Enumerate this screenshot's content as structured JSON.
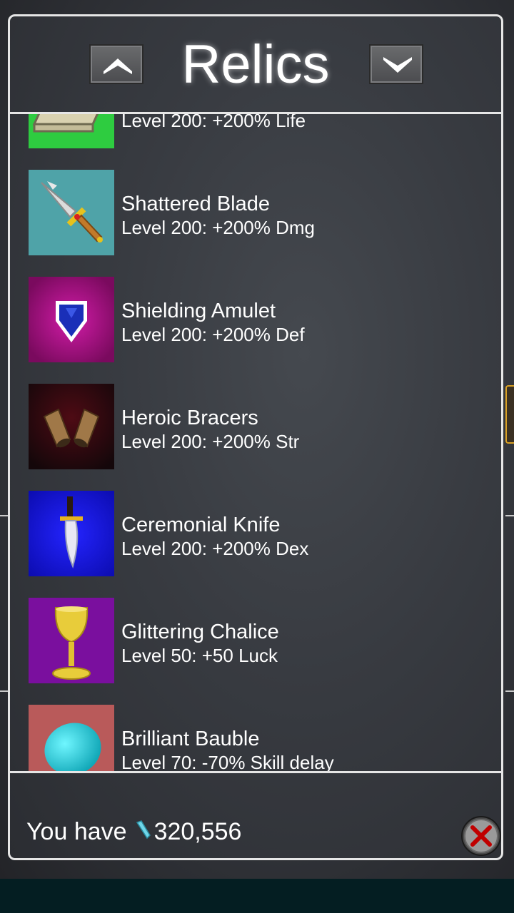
{
  "window": {
    "title": "Relics"
  },
  "nav": {
    "up_icon": "chevron-up-icon",
    "down_icon": "chevron-down-icon"
  },
  "items": [
    {
      "name": "",
      "desc": "Level 200: +200% Life",
      "bg": "#2ecc40",
      "icon": "book-icon"
    },
    {
      "name": "Shattered Blade",
      "desc": "Level 200: +200% Dmg",
      "bg": "#4fa3a8",
      "icon": "sword-icon"
    },
    {
      "name": "Shielding Amulet",
      "desc": "Level 200: +200% Def",
      "bg": "#b0158c",
      "icon": "amulet-icon"
    },
    {
      "name": "Heroic Bracers",
      "desc": "Level 200: +200% Str",
      "bg": "#4a0912",
      "icon": "bracers-icon"
    },
    {
      "name": "Ceremonial Knife",
      "desc": "Level 200: +200% Dex",
      "bg": "#1414d8",
      "icon": "knife-icon"
    },
    {
      "name": "Glittering Chalice",
      "desc": "Level 50: +50 Luck",
      "bg": "#7a0f9e",
      "icon": "chalice-icon"
    },
    {
      "name": "Brilliant Bauble",
      "desc": "Level 70: -70% Skill delay",
      "bg": "#b95a5a",
      "icon": "bauble-icon"
    }
  ],
  "footer": {
    "label": "You have",
    "amount": "320,556",
    "currency_icon": "crystal-icon"
  },
  "colors": {
    "panel_border": "#e6e6e6",
    "text": "#ffffff",
    "close_x": "#c00000"
  }
}
